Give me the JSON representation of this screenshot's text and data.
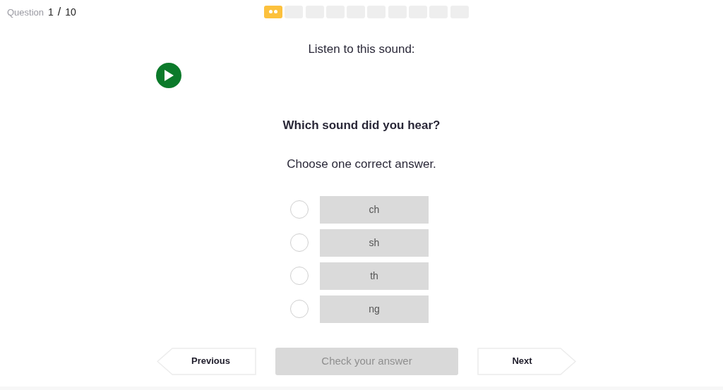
{
  "header": {
    "label": "Question",
    "current": "1",
    "separator": "/",
    "total": "10"
  },
  "progress": [
    {
      "selected": true
    },
    {
      "selected": false
    },
    {
      "selected": false
    },
    {
      "selected": false
    },
    {
      "selected": false
    },
    {
      "selected": false
    },
    {
      "selected": false
    },
    {
      "selected": false
    },
    {
      "selected": false
    },
    {
      "selected": false
    }
  ],
  "prompt": "Listen to this sound:",
  "question": "Which sound did you hear?",
  "instruction": "Choose one correct answer.",
  "options": [
    {
      "label": "ch",
      "selected": false
    },
    {
      "label": "sh",
      "selected": false
    },
    {
      "label": "th",
      "selected": false
    },
    {
      "label": "ng",
      "selected": false
    }
  ],
  "buttons": {
    "previous": "Previous",
    "check": {
      "label": "Check your answer",
      "disabled": true
    },
    "next": "Next"
  }
}
